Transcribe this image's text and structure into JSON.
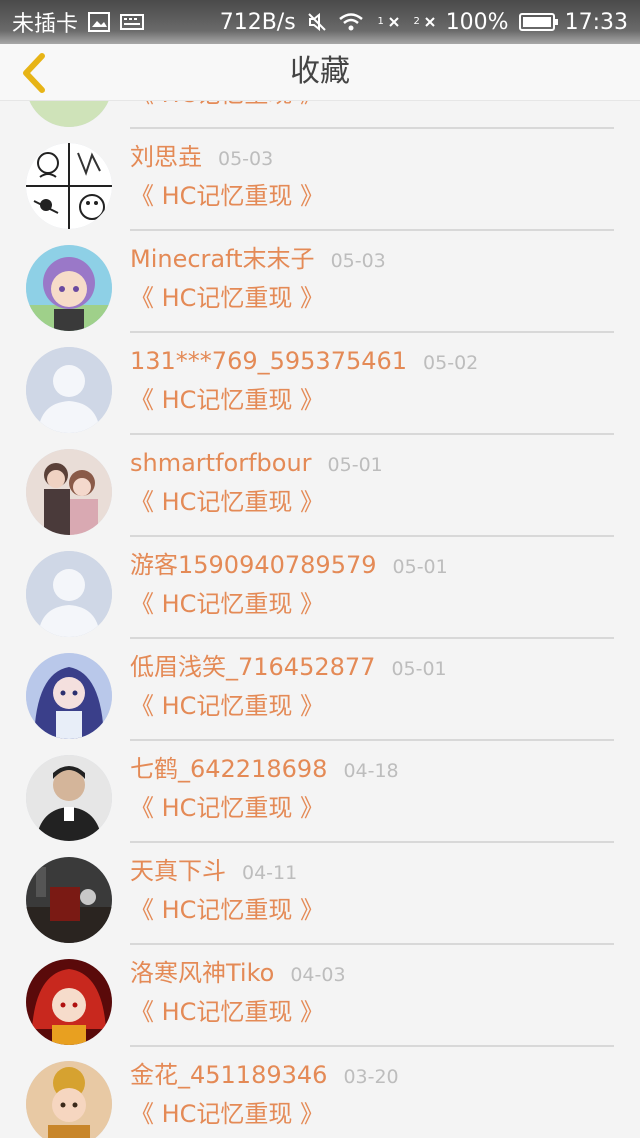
{
  "status_bar": {
    "carrier": "未插卡",
    "speed": "712B/s",
    "sim1_label": "1",
    "sim2_label": "2",
    "battery": "100%",
    "battery_level": 1.0,
    "time": "17:33"
  },
  "header": {
    "title": "收藏"
  },
  "favorites": [
    {
      "name": "",
      "date": "",
      "work": "《 HC记忆重现 》",
      "avatar_style": "partial"
    },
    {
      "name": "刘思垚",
      "date": "05-03",
      "work": "《 HC记忆重现 》",
      "avatar_style": "comic"
    },
    {
      "name": "Minecraft末末子",
      "date": "05-03",
      "work": "《 HC记忆重现 》",
      "avatar_style": "anime-purple"
    },
    {
      "name": "131***769_595375461",
      "date": "05-02",
      "work": "《 HC记忆重现 》",
      "avatar_style": "default"
    },
    {
      "name": "shmartforfbour",
      "date": "05-01",
      "work": "《 HC记忆重现 》",
      "avatar_style": "couple"
    },
    {
      "name": "游客1590940789579",
      "date": "05-01",
      "work": "《 HC记忆重现 》",
      "avatar_style": "default"
    },
    {
      "name": "低眉浅笑_716452877",
      "date": "05-01",
      "work": "《 HC记忆重现 》",
      "avatar_style": "anime-blue"
    },
    {
      "name": "七鹤_642218698",
      "date": "04-18",
      "work": "《 HC记忆重现 》",
      "avatar_style": "photo-man"
    },
    {
      "name": "天真下斗",
      "date": "04-11",
      "work": "《 HC记忆重现 》",
      "avatar_style": "dark-scene"
    },
    {
      "name": "洛寒风神Tiko",
      "date": "04-03",
      "work": "《 HC记忆重现 》",
      "avatar_style": "anime-red"
    },
    {
      "name": "金花_451189346",
      "date": "03-20",
      "work": "《 HC记忆重现 》",
      "avatar_style": "baby"
    }
  ],
  "colors": {
    "accent": "#e48a56",
    "date": "#bdbdbd",
    "back_arrow": "#e7b416",
    "divider": "#d8d8d8"
  }
}
